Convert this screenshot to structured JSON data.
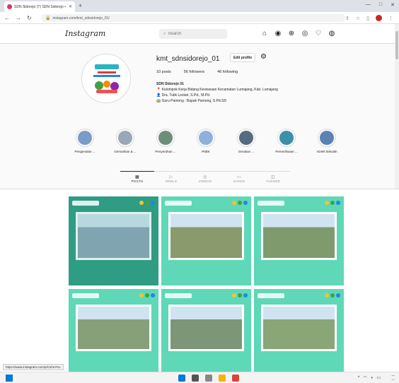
{
  "browser": {
    "tab_title": "SDN Sidorejo (T) SDN Sidorejo • Inst...",
    "url": "instagram.com/kmt_sdnsidorejo_01/",
    "new_tab_symbol": "+"
  },
  "instagram": {
    "logo": "Instagram",
    "search_placeholder": "Search",
    "nav_icons": [
      "home-icon",
      "messenger-icon",
      "new-post-icon",
      "explore-icon",
      "heart-icon",
      "profile-avatar-icon"
    ]
  },
  "profile": {
    "username": "kmt_sdnsidorejo_01",
    "edit_label": "Edit profile",
    "posts": "10 posts",
    "followers": "56 followers",
    "following": "46 following",
    "bio_name": "SDN Sidorejo 01",
    "bio_lines": [
      "📍 Kelompok Kerja Bidang Kesiswaan Kecamatan Lumajang, Kab. Lumajang",
      "👤 Dra. Tutik Lestari, S.Pd., M.Pd.",
      "🏫 Guru Pamong : Bapak Pamong, S.Pd.SD"
    ]
  },
  "highlights": [
    {
      "label": "Pengenalan ...",
      "color": "#7a9cc6"
    },
    {
      "label": "Gemarikan & ...",
      "color": "#9aa7b8"
    },
    {
      "label": "Penyerahan ...",
      "color": "#6b8f7a"
    },
    {
      "label": "P5BK",
      "color": "#8fb0d9"
    },
    {
      "label": "Gerakan ...",
      "color": "#556b80"
    },
    {
      "label": "Pemeriksaan ...",
      "color": "#3c8fa8"
    },
    {
      "label": "ADIW Sekolah",
      "color": "#5a82b5"
    }
  ],
  "tabs": [
    {
      "icon": "▦",
      "label": "POSTS"
    },
    {
      "icon": "▷",
      "label": "REELS"
    },
    {
      "icon": "◎",
      "label": "VIDEOS"
    },
    {
      "icon": "▭",
      "label": "SAVED"
    },
    {
      "icon": "◫",
      "label": "TAGGED"
    }
  ],
  "grid_posts": [
    {
      "photo_color": "#8fa6b8"
    },
    {
      "photo_color": "#8b9a6c"
    },
    {
      "photo_color": "#7f9b6d"
    },
    {
      "photo_color": "#87a07a"
    },
    {
      "photo_color": "#7c9677"
    },
    {
      "photo_color": "#8aa576"
    }
  ],
  "status_url": "https://www.instagram.com/p/CxhnYKx"
}
